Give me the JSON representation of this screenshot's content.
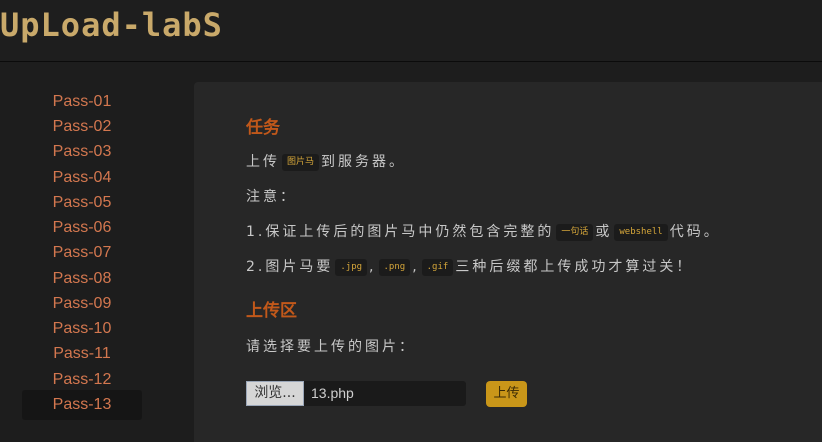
{
  "header": {
    "logo_text": "UpLoad-labS"
  },
  "sidebar": {
    "items": [
      {
        "label": "Pass-01"
      },
      {
        "label": "Pass-02"
      },
      {
        "label": "Pass-03"
      },
      {
        "label": "Pass-04"
      },
      {
        "label": "Pass-05"
      },
      {
        "label": "Pass-06"
      },
      {
        "label": "Pass-07"
      },
      {
        "label": "Pass-08"
      },
      {
        "label": "Pass-09"
      },
      {
        "label": "Pass-10"
      },
      {
        "label": "Pass-11"
      },
      {
        "label": "Pass-12"
      },
      {
        "label": "Pass-13",
        "active": true
      }
    ]
  },
  "task": {
    "title": "任务",
    "line1_pre": "上传",
    "line1_code": "图片马",
    "line1_post": "到服务器。",
    "note": "注意：",
    "line3_pre": "1.保证上传后的图片马中仍然包含完整的",
    "line3_code1": "一句话",
    "line3_mid": "或",
    "line3_code2": "webshell",
    "line3_post": "代码。",
    "line4_pre": "2.图片马要",
    "line4_code1": ".jpg",
    "line4_sep1": ",",
    "line4_code2": ".png",
    "line4_sep2": ",",
    "line4_code3": ".gif",
    "line4_post": "三种后缀都上传成功才算过关！"
  },
  "upload": {
    "title": "上传区",
    "prompt": "请选择要上传的图片：",
    "browse_label": "浏览...",
    "file_name": "13.php",
    "submit_label": "上传"
  },
  "colors": {
    "accent": "#c1581a",
    "nav_link": "#d3774f",
    "code_text": "#d5a63a",
    "upload_button": "#c99619"
  }
}
